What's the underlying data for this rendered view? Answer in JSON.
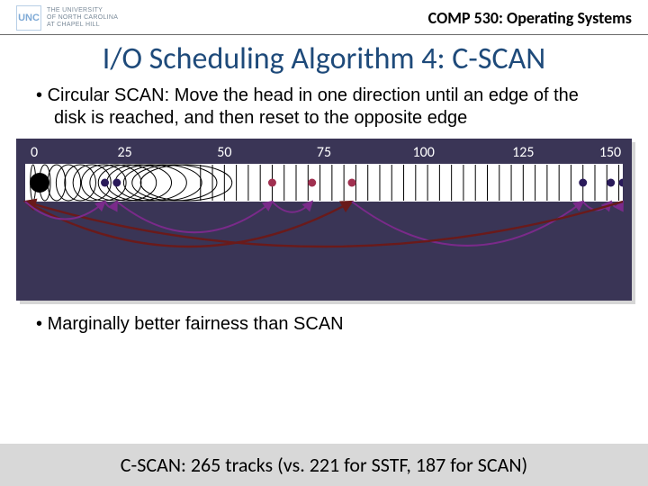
{
  "header": {
    "logo_mark": "UNC",
    "logo_text_line1": "THE UNIVERSITY",
    "logo_text_line2": "of NORTH CAROLINA",
    "logo_text_line3": "at CHAPEL HILL",
    "course": "COMP 530: Operating Systems"
  },
  "title": "I/O Scheduling Algorithm 4: C-SCAN",
  "bullets": {
    "b1": "Circular SCAN: Move the head in one direction until an edge of the disk is reached, and then reset to the opposite edge",
    "b2": "Marginally better fairness than SCAN"
  },
  "footer": "C-SCAN: 265 tracks (vs. 221 for SSTF, 187 for SCAN)",
  "chart_data": {
    "type": "other",
    "title": "C-SCAN disk head movement",
    "axis": {
      "min": 0,
      "max": 150,
      "ticks": [
        0,
        25,
        50,
        75,
        100,
        125,
        150
      ]
    },
    "head_start": 0,
    "requests": [
      20,
      23,
      62,
      72,
      82,
      140,
      147,
      150
    ],
    "movement_sequence": [
      82,
      140,
      147,
      150,
      0,
      20,
      23,
      62,
      72
    ],
    "arc_colors": {
      "purple": "#7a2a8a",
      "dark_red": "#6a1a1a"
    }
  }
}
